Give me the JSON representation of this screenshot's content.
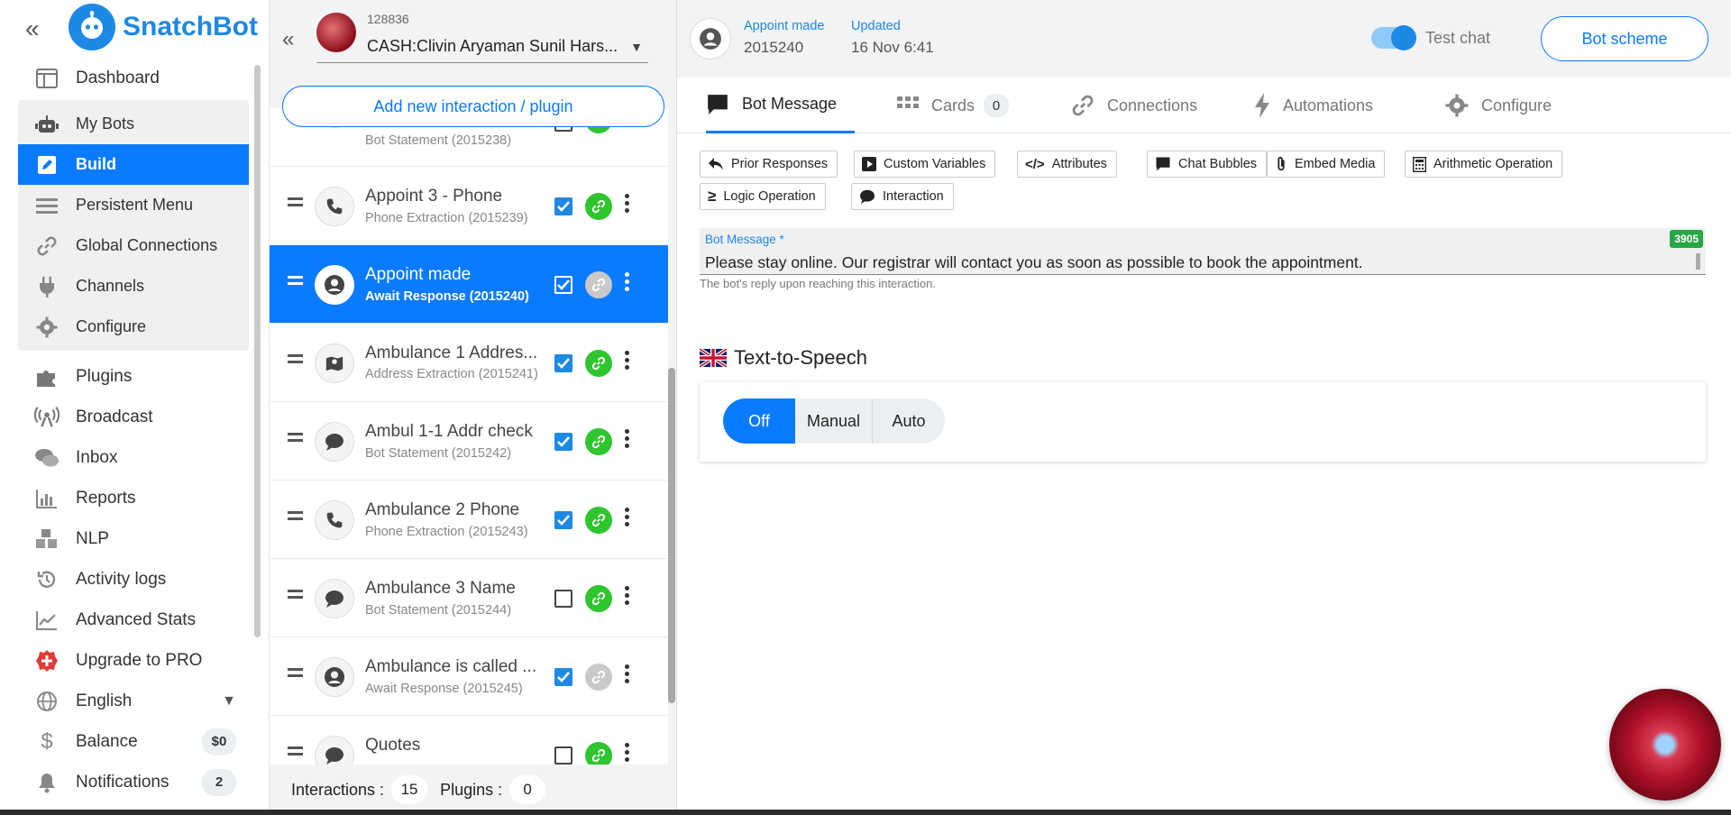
{
  "brand": {
    "name": "SnatchBot"
  },
  "sidebar": {
    "items_top": [
      {
        "label": "Dashboard",
        "icon": "dashboard-icon"
      }
    ],
    "group": [
      {
        "label": "My Bots",
        "icon": "robot-icon",
        "active": false
      },
      {
        "label": "Build",
        "icon": "edit-icon",
        "active": true
      },
      {
        "label": "Persistent Menu",
        "icon": "menu-icon",
        "active": false
      },
      {
        "label": "Global Connections",
        "icon": "link-icon",
        "active": false
      },
      {
        "label": "Channels",
        "icon": "plug-icon",
        "active": false
      },
      {
        "label": "Configure",
        "icon": "gear-icon",
        "active": false
      }
    ],
    "items_bottom": [
      {
        "label": "Plugins",
        "icon": "puzzle-icon"
      },
      {
        "label": "Broadcast",
        "icon": "broadcast-icon"
      },
      {
        "label": "Inbox",
        "icon": "chat-icon"
      },
      {
        "label": "Reports",
        "icon": "bar-chart-icon"
      },
      {
        "label": "NLP",
        "icon": "cubes-icon"
      },
      {
        "label": "Activity logs",
        "icon": "history-icon"
      },
      {
        "label": "Advanced Stats",
        "icon": "line-chart-icon"
      },
      {
        "label": "Upgrade to PRO",
        "icon": "plus-badge-icon"
      }
    ],
    "language": "English",
    "balance": {
      "label": "Balance",
      "value": "$0"
    },
    "notifications": {
      "label": "Notifications",
      "count": "2"
    }
  },
  "bot": {
    "id": "128836",
    "name": "CASH:Clivin Aryaman Sunil Hars..."
  },
  "middle": {
    "add_button": "Add new interaction / plugin",
    "interactions": [
      {
        "title": "",
        "subtitle": "Bot Statement (2015238)",
        "type": "chat",
        "checked": false,
        "link": "green",
        "partial": true
      },
      {
        "title": "Appoint 3 - Phone",
        "subtitle": "Phone Extraction (2015239)",
        "type": "phone",
        "checked": true,
        "link": "green"
      },
      {
        "title": "Appoint made",
        "subtitle": "Await Response (2015240)",
        "type": "user",
        "checked": true,
        "link": "grey",
        "active": true
      },
      {
        "title": "Ambulance 1 Addres...",
        "subtitle": "Address Extraction (2015241)",
        "type": "map",
        "checked": true,
        "link": "green"
      },
      {
        "title": "Ambul 1-1 Addr check",
        "subtitle": "Bot Statement (2015242)",
        "type": "chat",
        "checked": true,
        "link": "green"
      },
      {
        "title": "Ambulance 2 Phone",
        "subtitle": "Phone Extraction (2015243)",
        "type": "phone",
        "checked": true,
        "link": "green"
      },
      {
        "title": "Ambulance 3 Name",
        "subtitle": "Bot Statement (2015244)",
        "type": "chat",
        "checked": false,
        "link": "green"
      },
      {
        "title": "Ambulance is called ...",
        "subtitle": "Await Response (2015245)",
        "type": "user",
        "checked": true,
        "link": "grey"
      },
      {
        "title": "Quotes",
        "subtitle": "",
        "type": "chat",
        "checked": false,
        "link": "green"
      }
    ],
    "footer": {
      "interactions_label": "Interactions :",
      "interactions_count": "15",
      "plugins_label": "Plugins :",
      "plugins_count": "0"
    }
  },
  "right": {
    "header": {
      "name_label": "Appoint made",
      "name_value": "2015240",
      "updated_label": "Updated",
      "updated_value": "16 Nov 6:41",
      "test_chat": "Test chat",
      "scheme_button": "Bot scheme"
    },
    "tabs": [
      {
        "label": "Bot Message",
        "icon": "message-icon",
        "active": true
      },
      {
        "label": "Cards",
        "icon": "grid-icon",
        "count": "0"
      },
      {
        "label": "Connections",
        "icon": "link-icon"
      },
      {
        "label": "Automations",
        "icon": "bolt-icon"
      },
      {
        "label": "Configure",
        "icon": "gear-icon"
      }
    ],
    "chips": [
      {
        "label": "Prior Responses",
        "icon": "reply-icon"
      },
      {
        "label": "Custom Variables",
        "icon": "play-square-icon"
      },
      {
        "label": "Attributes",
        "icon": "code-icon"
      },
      {
        "label": "Chat Bubbles",
        "icon": "bubble-icon"
      },
      {
        "label": "Embed Media",
        "icon": "paperclip-icon"
      },
      {
        "label": "Arithmetic Operation",
        "icon": "calculator-icon"
      },
      {
        "label": "Logic Operation",
        "icon": "logic-icon"
      },
      {
        "label": "Interaction",
        "icon": "speech-icon"
      }
    ],
    "message": {
      "label": "Bot Message *",
      "counter": "3905",
      "text": "Please stay online. Our registrar will contact you as soon as possible to book the appointment.",
      "hint": "The bot's reply upon reaching this interaction."
    },
    "tts": {
      "title": "Text-to-Speech",
      "options": [
        "Off",
        "Manual",
        "Auto"
      ],
      "selected": "Off"
    }
  },
  "colors": {
    "accent": "#0a7bff",
    "brand": "#1e88e5",
    "green": "#2ec52e",
    "counter": "#27a845"
  }
}
